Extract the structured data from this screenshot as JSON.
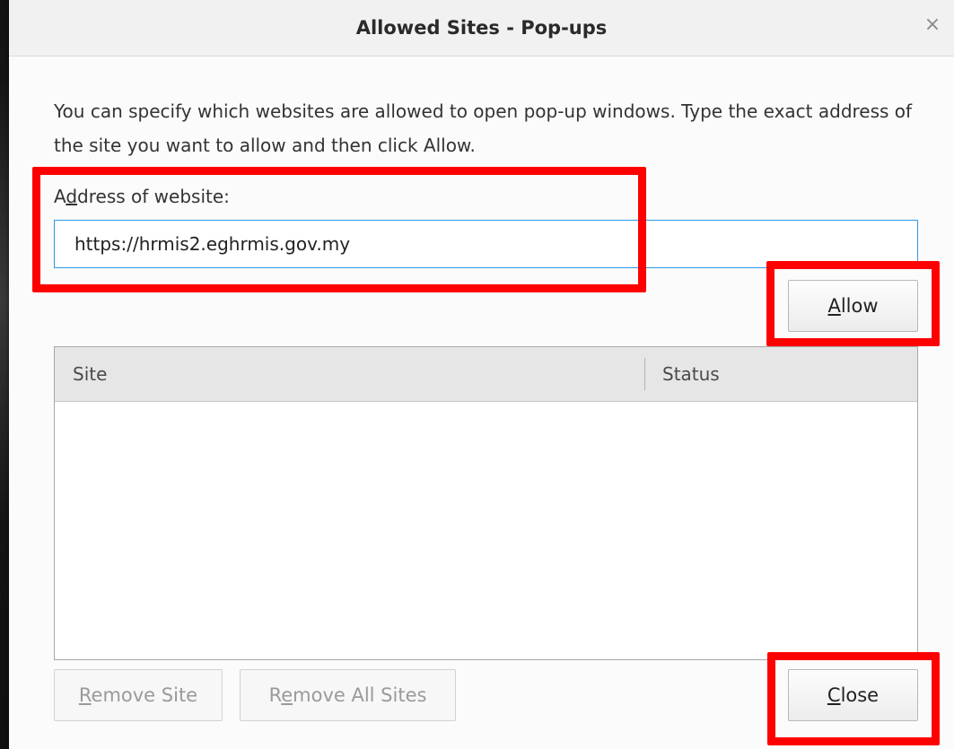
{
  "dialog": {
    "title": "Allowed Sites - Pop-ups",
    "close_glyph": "×",
    "close_icon": "close-icon",
    "description": "You can specify which websites are allowed to open pop-up windows. Type the exact address of the site you want to allow and then click Allow."
  },
  "address": {
    "label_pre": "A",
    "label_accel": "d",
    "label_post": "dress of website:",
    "value": "https://hrmis2.eghrmis.gov.my"
  },
  "buttons": {
    "allow": {
      "accel": "A",
      "rest": "llow"
    },
    "remove_site": {
      "accel": "R",
      "rest": "emove Site"
    },
    "remove_all": {
      "pre": "R",
      "accel": "e",
      "rest": "move All Sites"
    },
    "close": {
      "accel": "C",
      "rest": "lose"
    }
  },
  "table": {
    "columns": [
      "Site",
      "Status"
    ],
    "rows": []
  },
  "colors": {
    "highlight": "#ff0000",
    "input_focus": "#2c9ae6"
  }
}
